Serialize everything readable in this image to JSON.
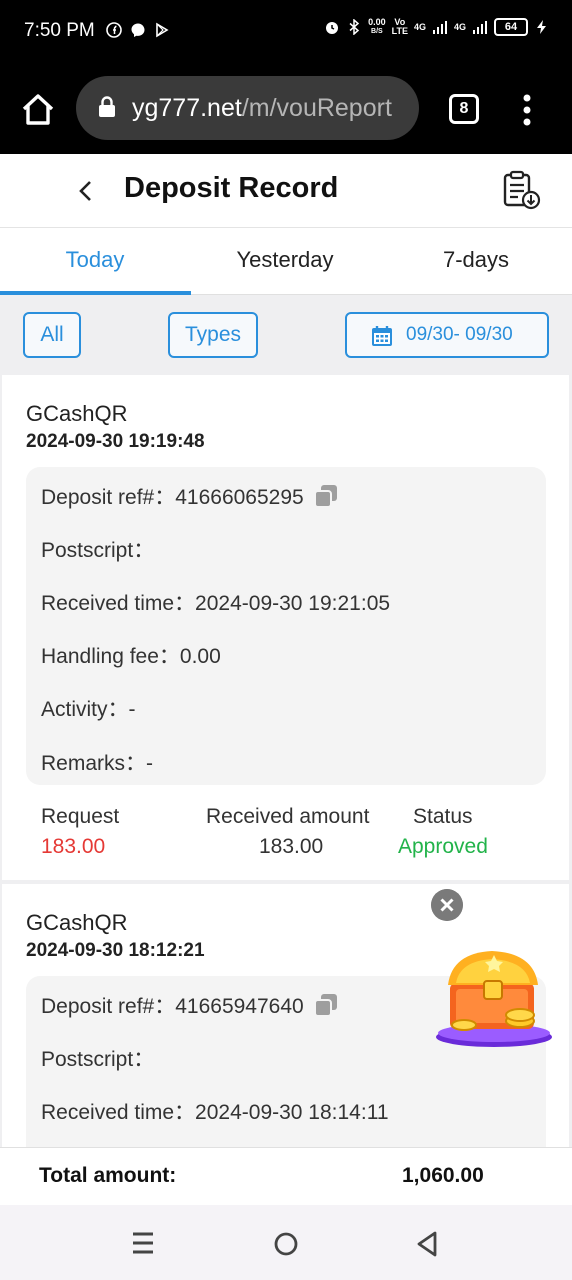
{
  "status_bar": {
    "time": "7:50 PM",
    "net_speed_value": "0.00",
    "net_speed_unit": "B/S",
    "volte_top": "Vo",
    "volte_bottom": "LTE",
    "signal1": "4G",
    "signal2": "4G",
    "battery": "64"
  },
  "browser": {
    "url_domain": "yg777.net",
    "url_path": "/m/vouReport",
    "tab_count": "8"
  },
  "header": {
    "title": "Deposit Record"
  },
  "tabs": [
    {
      "label": "Today",
      "active": true
    },
    {
      "label": "Yesterday",
      "active": false
    },
    {
      "label": "7-days",
      "active": false
    }
  ],
  "filters": {
    "all_label": "All",
    "types_label": "Types",
    "date_range": "09/30- 09/30"
  },
  "records": [
    {
      "method": "GCashQR",
      "datetime": "2024-09-30 19:19:48",
      "deposit_ref": "Deposit ref#：41666065295",
      "postscript": "Postscript：",
      "received_time": "Received time：2024-09-30 19:21:05",
      "handling_fee": "Handling fee：0.00",
      "activity": "Activity：-",
      "remarks": "Remarks：-",
      "request_label": "Request",
      "request_value": "183.00",
      "received_label": "Received amount",
      "received_value": "183.00",
      "status_label": "Status",
      "status_value": "Approved"
    },
    {
      "method": "GCashQR",
      "datetime": "2024-09-30 18:12:21",
      "deposit_ref": "Deposit ref#：41665947640",
      "postscript": "Postscript：",
      "received_time": "Received time：2024-09-30 18:14:11"
    }
  ],
  "totals": {
    "label": "Total amount:",
    "value": "1,060.00"
  },
  "colors": {
    "accent": "#2a8fdc",
    "request": "#e53935",
    "approved": "#22b34a"
  }
}
